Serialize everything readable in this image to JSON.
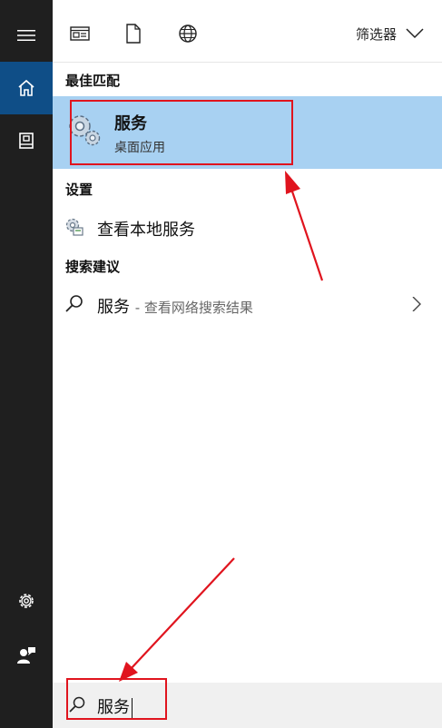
{
  "filter": {
    "label": "筛选器"
  },
  "sections": {
    "best_match": "最佳匹配",
    "settings": "设置",
    "search_suggestions": "搜索建议"
  },
  "best_result": {
    "name": "服务",
    "subtitle": "桌面应用"
  },
  "settings_item": {
    "label": "查看本地服务"
  },
  "suggestion": {
    "query": "服务",
    "suffix": "- 查看网络搜索结果"
  },
  "search": {
    "value": "服务"
  },
  "colors": {
    "sidebar": "#1f1f1f",
    "active_nav": "#0f4e87",
    "selected_result": "#a8d1f2",
    "annotation": "#e0141e"
  }
}
